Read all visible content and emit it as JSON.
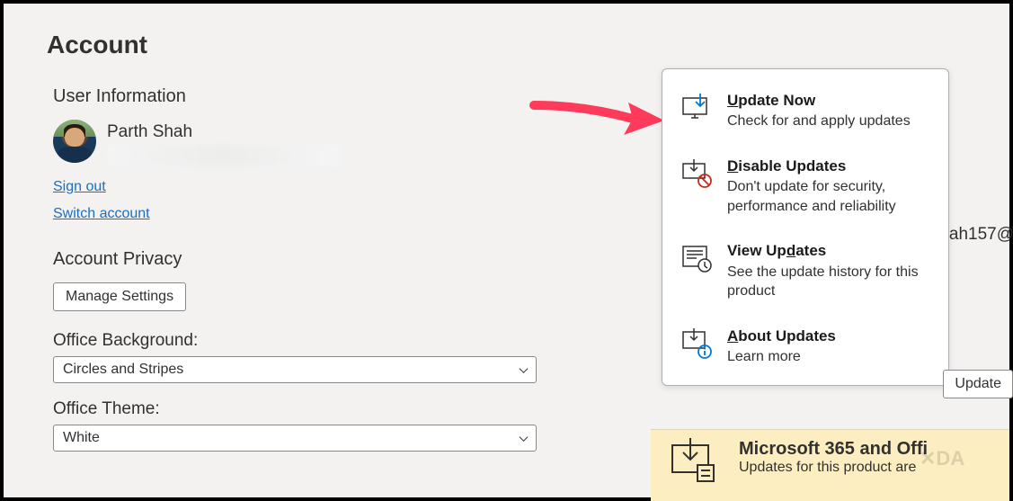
{
  "page": {
    "title": "Account"
  },
  "sections": {
    "user_info": {
      "heading": "User Information",
      "name": "Parth Shah",
      "sign_out": "Sign out",
      "switch_account": "Switch account"
    },
    "privacy": {
      "heading": "Account Privacy",
      "manage_btn": "Manage Settings"
    },
    "bg": {
      "label": "Office Background:",
      "value": "Circles and Stripes"
    },
    "theme": {
      "label": "Office Theme:",
      "value": "White"
    }
  },
  "popup": {
    "items": [
      {
        "title_underline": "U",
        "title_rest": "pdate Now",
        "desc": "Check for and apply updates"
      },
      {
        "title_underline": "D",
        "title_rest": "isable Updates",
        "desc": "Don't update for security, performance and reliability"
      },
      {
        "title_prefix": "View Up",
        "title_underline": "d",
        "title_rest": "ates",
        "desc": "See the update history for this product"
      },
      {
        "title_underline": "A",
        "title_rest": "bout Updates",
        "desc": "Learn more"
      }
    ]
  },
  "side": {
    "update_btn": "Update",
    "banner_title": "Microsoft 365 and Offi",
    "banner_sub": "Updates for this product are",
    "update_label": "Update"
  },
  "partial_email": "ah157@"
}
